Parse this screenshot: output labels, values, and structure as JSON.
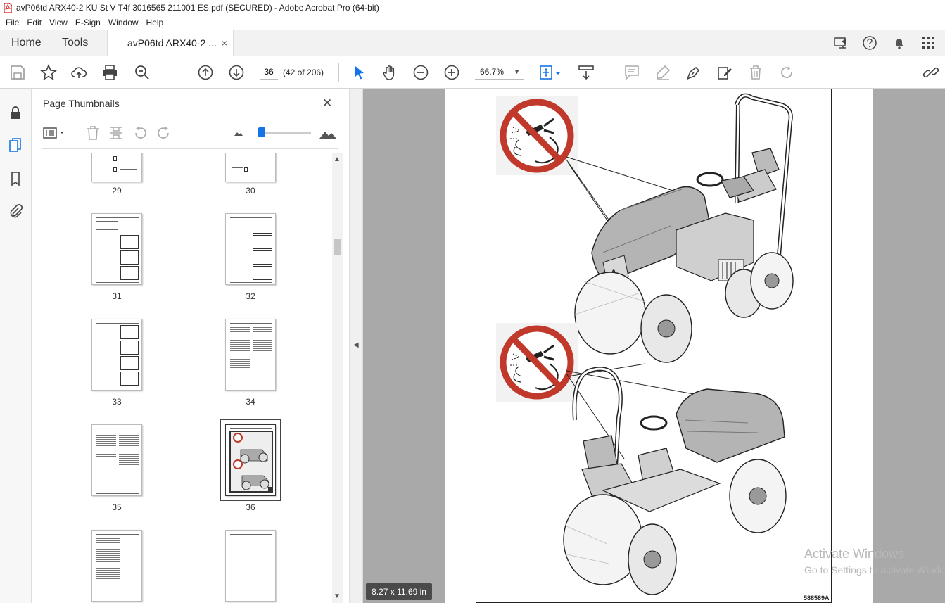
{
  "window": {
    "title": "avP06td ARX40-2 KU St V T4f 3016565 211001 ES.pdf (SECURED) - Adobe Acrobat Pro (64-bit)"
  },
  "menu": [
    "File",
    "Edit",
    "View",
    "E-Sign",
    "Window",
    "Help"
  ],
  "tabs": {
    "home": "Home",
    "tools": "Tools",
    "document": "avP06td ARX40-2 ...",
    "close": "×"
  },
  "toolbar": {
    "page_current": "36",
    "page_of": "(42 of 206)",
    "zoom": "66.7%",
    "zoom_caret": "▼"
  },
  "thumbnail_panel": {
    "title": "Page Thumbnails",
    "close": "✕",
    "size_slider_value": 0.0,
    "pages": [
      {
        "label": "29",
        "selected": false
      },
      {
        "label": "30",
        "selected": false
      },
      {
        "label": "31",
        "selected": false
      },
      {
        "label": "32",
        "selected": false
      },
      {
        "label": "33",
        "selected": false
      },
      {
        "label": "34",
        "selected": false
      },
      {
        "label": "35",
        "selected": false
      },
      {
        "label": "36",
        "selected": true
      },
      {
        "label": "",
        "selected": false
      },
      {
        "label": "",
        "selected": false
      }
    ]
  },
  "viewer": {
    "page_size": "8.27 x 11.69 in",
    "figure_code": "588589A"
  },
  "watermark": {
    "line1": "Activate Windows",
    "line2": "Go to Settings to activate Windows."
  },
  "colors": {
    "accent": "#1473e6",
    "prohibition_red": "#c0392b",
    "viewer_bg": "#a9a9a9"
  }
}
